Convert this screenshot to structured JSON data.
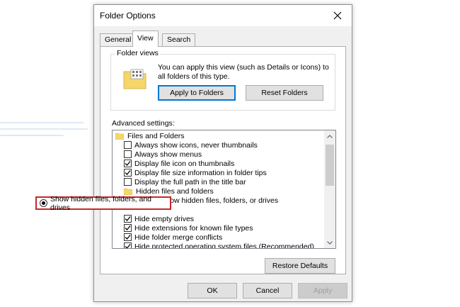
{
  "window": {
    "title": "Folder Options"
  },
  "tabs": [
    {
      "label": "General"
    },
    {
      "label": "View"
    },
    {
      "label": "Search"
    }
  ],
  "folder_views": {
    "label": "Folder views",
    "description": "You can apply this view (such as Details or Icons) to all folders of this type.",
    "apply_button": "Apply to Folders",
    "reset_button": "Reset Folders"
  },
  "advanced": {
    "label": "Advanced settings:",
    "items": [
      {
        "type": "folder",
        "label": "Files and Folders"
      },
      {
        "type": "checkbox",
        "checked": false,
        "label": "Always show icons, never thumbnails"
      },
      {
        "type": "checkbox",
        "checked": false,
        "label": "Always show menus"
      },
      {
        "type": "checkbox",
        "checked": true,
        "label": "Display file icon on thumbnails"
      },
      {
        "type": "checkbox",
        "checked": true,
        "label": "Display file size information in folder tips"
      },
      {
        "type": "checkbox",
        "checked": false,
        "label": "Display the full path in the title bar"
      },
      {
        "type": "folder",
        "label": "Hidden files and folders"
      },
      {
        "type": "radio",
        "checked": false,
        "label": "Don't show hidden files, folders, or drives"
      },
      {
        "type": "radio",
        "checked": true,
        "label": "Show hidden files, folders, and drives"
      },
      {
        "type": "checkbox",
        "checked": true,
        "label": "Hide empty drives"
      },
      {
        "type": "checkbox",
        "checked": true,
        "label": "Hide extensions for known file types"
      },
      {
        "type": "checkbox",
        "checked": true,
        "label": "Hide folder merge conflicts"
      },
      {
        "type": "checkbox",
        "checked": true,
        "label": "Hide protected operating system files (Recommended)"
      }
    ]
  },
  "restore_button": "Restore Defaults",
  "footer": {
    "ok": "OK",
    "cancel": "Cancel",
    "apply": "Apply"
  },
  "colors": {
    "highlight": "#c62828",
    "focus": "#0078d7",
    "folder": "#f5d66b"
  }
}
